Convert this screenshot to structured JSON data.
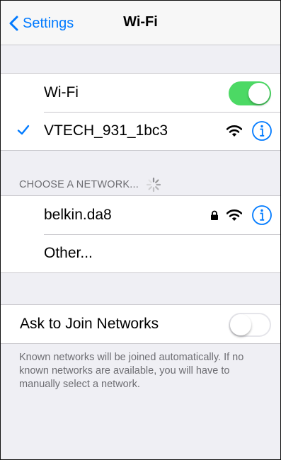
{
  "nav": {
    "back_label": "Settings",
    "title": "Wi-Fi"
  },
  "wifi_group": {
    "toggle_label": "Wi-Fi",
    "toggle_on": true,
    "connected_network": "VTECH_931_1bc3"
  },
  "choose_network": {
    "header": "CHOOSE A NETWORK...",
    "networks": [
      {
        "name": "belkin.da8",
        "locked": true
      },
      {
        "name": "Other...",
        "locked": false
      }
    ]
  },
  "ask_to_join": {
    "label": "Ask to Join Networks",
    "toggle_on": false,
    "footer": "Known networks will be joined automatically. If no known networks are available, you will have to manually select a network."
  },
  "colors": {
    "accent": "#007aff",
    "toggle_on": "#4cd964",
    "background": "#efeff4",
    "secondary_text": "#6d6d72"
  },
  "icons": [
    "chevron-left-icon",
    "checkmark-icon",
    "wifi-icon",
    "info-icon",
    "lock-icon",
    "spinner-icon"
  ]
}
